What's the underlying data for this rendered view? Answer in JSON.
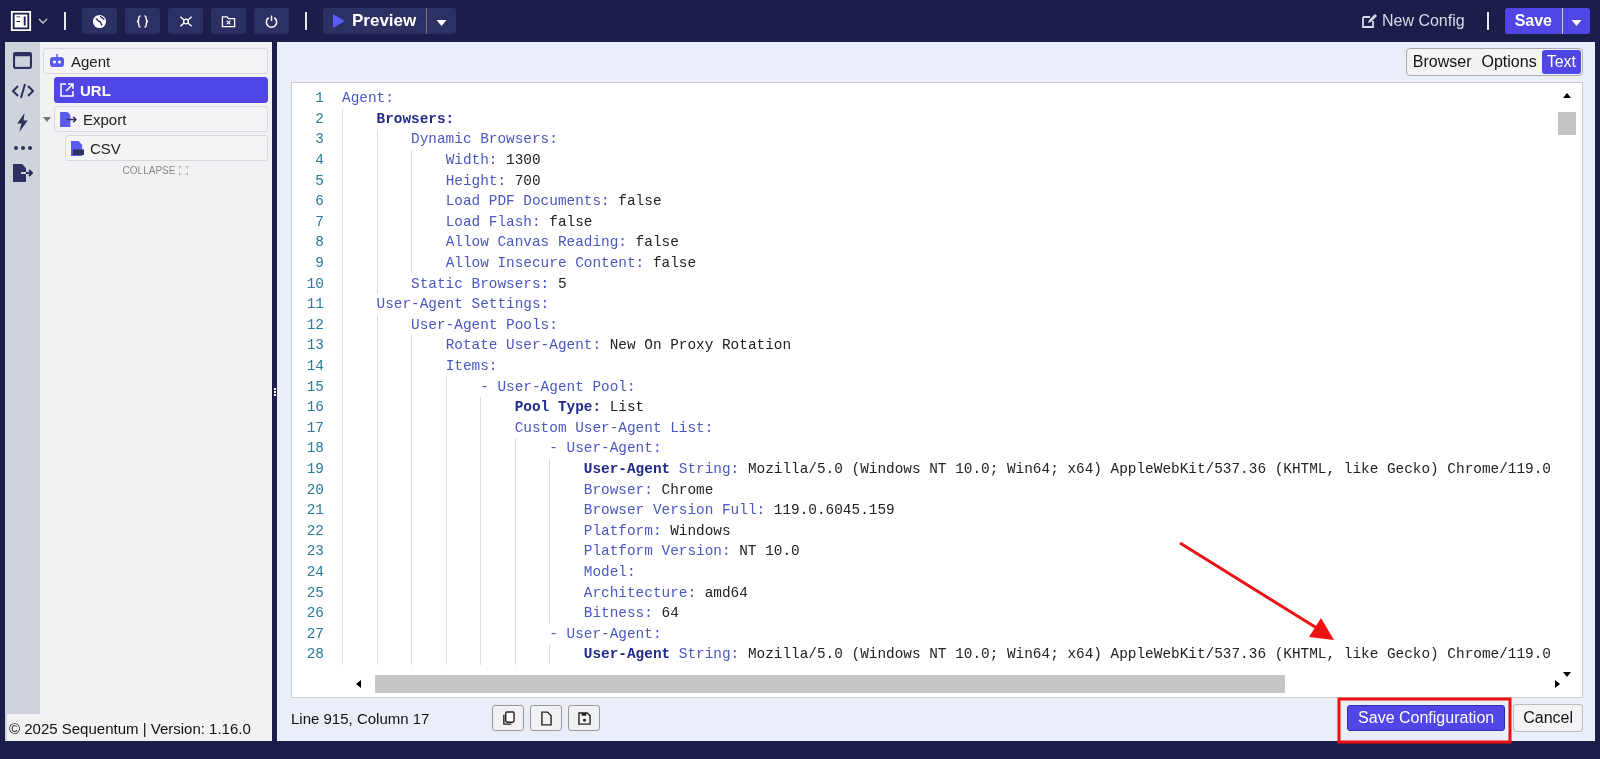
{
  "toolbar": {
    "preview": "Preview",
    "new_config": "New Config",
    "save": "Save"
  },
  "sidebar": {
    "tree": [
      {
        "kind": "agent",
        "label": "Agent",
        "selected": false,
        "children": [
          {
            "kind": "link",
            "label": "URL",
            "selected": true
          },
          {
            "kind": "export",
            "label": "Export",
            "selected": false,
            "expanded": true,
            "children": [
              {
                "kind": "csv",
                "label": "CSV",
                "selected": false
              }
            ]
          }
        ]
      }
    ],
    "collapse": "COLLAPSE",
    "footer": "© 2025 Sequentum | Version: 1.16.0"
  },
  "view_tabs": [
    {
      "label": "Browser",
      "selected": false
    },
    {
      "label": "Options",
      "selected": false
    },
    {
      "label": "Text",
      "selected": true
    }
  ],
  "editor": {
    "lines": [
      {
        "number": "1",
        "key": "Agent:"
      },
      {
        "number": "2",
        "key": "    **Browsers:**"
      },
      {
        "number": "3",
        "key": "        Dynamic Browsers:"
      },
      {
        "number": "4",
        "key": "            Width:",
        "value": "1300"
      },
      {
        "number": "5",
        "key": "            Height:",
        "value": "700"
      },
      {
        "number": "6",
        "key": "            Load PDF Documents:",
        "value": "false"
      },
      {
        "number": "7",
        "key": "            Load Flash:",
        "value": "false"
      },
      {
        "number": "8",
        "key": "            Allow Canvas Reading:",
        "value": "false"
      },
      {
        "number": "9",
        "key": "            Allow Insecure Content:",
        "value": "false"
      },
      {
        "number": "10",
        "key": "        Static Browsers:",
        "value": "5"
      },
      {
        "number": "11",
        "key": "    User-Agent Settings:"
      },
      {
        "number": "12",
        "key": "        User-Agent Pools:"
      },
      {
        "number": "13",
        "key": "            Rotate User-Agent:",
        "value": "New On Proxy Rotation"
      },
      {
        "number": "14",
        "key": "            Items:"
      },
      {
        "number": "15",
        "key": "                - User-Agent Pool:"
      },
      {
        "number": "16",
        "key": "                    **Pool Type:**",
        "value": "List"
      },
      {
        "number": "17",
        "key": "                    Custom User-Agent List:"
      },
      {
        "number": "18",
        "key": "                        - User-Agent:"
      },
      {
        "number": "19",
        "key": "                            **User-Agent** String:",
        "value": "Mozilla/5.0 (Windows NT 10.0; Win64; x64) AppleWebKit/537.36 (KHTML, like Gecko) Chrome/119.0"
      },
      {
        "number": "20",
        "key": "                            Browser:",
        "value": "Chrome"
      },
      {
        "number": "21",
        "key": "                            Browser Version Full:",
        "value": "119.0.6045.159"
      },
      {
        "number": "22",
        "key": "                            Platform:",
        "value": "Windows"
      },
      {
        "number": "23",
        "key": "                            Platform Version:",
        "value": "NT 10.0"
      },
      {
        "number": "24",
        "key": "                            Model:"
      },
      {
        "number": "25",
        "key": "                            Architecture:",
        "value": "amd64"
      },
      {
        "number": "26",
        "key": "                            Bitness:",
        "value": "64"
      },
      {
        "number": "27",
        "key": "                        - User-Agent:"
      },
      {
        "number": "28",
        "key": "                            **User-Agent** String:",
        "value": "Mozilla/5.0 (Windows NT 10.0; Win64; x64) AppleWebKit/537.36 (KHTML, like Gecko) Chrome/119.0"
      }
    ]
  },
  "status": "Line 915, Column 17",
  "buttons": [
    "Save Configuration",
    "Cancel"
  ]
}
